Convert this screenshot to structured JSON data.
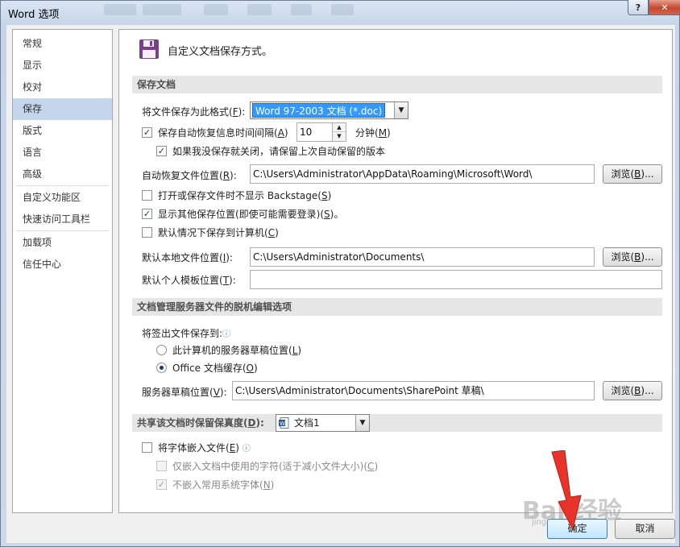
{
  "window": {
    "title": "Word 选项",
    "help_glyph": "?",
    "close_glyph": "✕"
  },
  "sidebar": {
    "items": [
      {
        "label": "常规"
      },
      {
        "label": "显示"
      },
      {
        "label": "校对"
      },
      {
        "label": "保存"
      },
      {
        "label": "版式"
      },
      {
        "label": "语言"
      },
      {
        "label": "高级"
      },
      {
        "label": "自定义功能区"
      },
      {
        "label": "快速访问工具栏"
      },
      {
        "label": "加载项"
      },
      {
        "label": "信任中心"
      }
    ],
    "selected": "保存"
  },
  "header": {
    "text": "自定义文档保存方式。",
    "icon": "floppy-disk-icon"
  },
  "save_docs": {
    "section_title": "保存文档",
    "format_label": "将文件保存为此格式(",
    "format_key": "F",
    "format_label_end": "):",
    "format_value": "Word 97-2003 文档 (*.doc)",
    "autorecover_label": "保存自动恢复信息时间间隔(",
    "autorecover_key": "A",
    "autorecover_label_end": ")",
    "autorecover_checked": "✓",
    "interval_value": "10",
    "minutes_label": "分钟(",
    "minutes_key": "M",
    "minutes_label_end": ")",
    "keep_last_label": "如果我没保存就关闭，请保留上次自动保留的版本",
    "keep_last_checked": "✓",
    "autorecover_location_label": "自动恢复文件位置(",
    "autorecover_location_key": "R",
    "autorecover_location_label_end": "):",
    "autorecover_location_value": "C:\\Users\\Administrator\\AppData\\Roaming\\Microsoft\\Word\\",
    "browse_label": "浏览(",
    "browse_key": "B",
    "browse_label_end": ")...",
    "no_backstage_label": "打开或保存文件时不显示 Backstage(",
    "no_backstage_key": "S",
    "no_backstage_label_end": ")",
    "show_other_label": "显示其他保存位置(即使可能需要登录)(",
    "show_other_key": "S",
    "show_other_label_end": ")。",
    "show_other_checked": "✓",
    "default_computer_label": "默认情况下保存到计算机(",
    "default_computer_key": "C",
    "default_computer_label_end": ")",
    "default_local_label": "默认本地文件位置(",
    "default_local_key": "I",
    "default_local_label_end": "):",
    "default_local_value": "C:\\Users\\Administrator\\Documents\\",
    "personal_template_label": "默认个人模板位置(",
    "personal_template_key": "T",
    "personal_template_label_end": "):",
    "personal_template_value": ""
  },
  "offline": {
    "section_title": "文档管理服务器文件的脱机编辑选项",
    "checkout_label": "将签出文件保存到:",
    "radio_server_label": "此计算机的服务器草稿位置(",
    "radio_server_key": "L",
    "radio_server_label_end": ")",
    "radio_office_label": "Office 文档缓存(",
    "radio_office_key": "O",
    "radio_office_label_end": ")",
    "drafts_label": "服务器草稿位置(",
    "drafts_key": "V",
    "drafts_label_end": "):",
    "drafts_value": "C:\\Users\\Administrator\\Documents\\SharePoint 草稿\\"
  },
  "fidelity": {
    "section_title_start": "共享该文档时保留保真度(",
    "section_title_key": "D",
    "section_title_end": "):",
    "doc_value": "文档1",
    "embed_label": "将字体嵌入文件(",
    "embed_key": "E",
    "embed_label_end": ")",
    "embed_used_label": "仅嵌入文档中使用的字符(适于减小文件大小)(",
    "embed_used_key": "C",
    "embed_used_label_end": ")",
    "no_common_label": "不嵌入常用系统字体(",
    "no_common_key": "N",
    "no_common_label_end": ")",
    "no_common_checked": "✓"
  },
  "footer": {
    "ok_label": "确定",
    "cancel_label": "取消"
  },
  "watermark": {
    "text": "Bai 经验",
    "sub": "jingyan.baidu.com"
  },
  "colors": {
    "selection": "#3399ff",
    "nav_selected": "#c5d6ec",
    "arrow": "#e8332a"
  }
}
